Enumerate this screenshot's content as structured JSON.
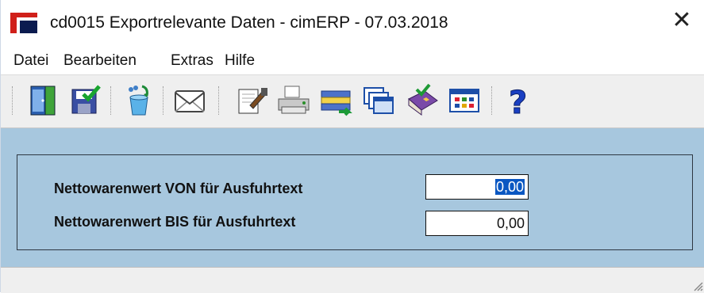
{
  "window": {
    "title": "cd0015 Exportrelevante Daten - cimERP - 07.03.2018",
    "close_glyph": "✕"
  },
  "menu": {
    "items": [
      "Datei",
      "Bearbeiten",
      "Extras",
      "Hilfe"
    ]
  },
  "toolbar": {
    "buttons": [
      {
        "icon": "exit-door-icon"
      },
      {
        "icon": "save-disk-icon"
      },
      {
        "icon": "recycle-bin-icon"
      },
      {
        "icon": "mail-envelope-icon"
      },
      {
        "icon": "edit-document-icon"
      },
      {
        "icon": "printer-icon"
      },
      {
        "icon": "transfer-list-icon"
      },
      {
        "icon": "windows-cascade-icon"
      },
      {
        "icon": "book-icon"
      },
      {
        "icon": "calculator-grid-icon"
      },
      {
        "icon": "help-question-icon"
      }
    ]
  },
  "form": {
    "fields": [
      {
        "label": "Nettowarenwert VON für Ausfuhrtext",
        "value": "0,00",
        "selected": true
      },
      {
        "label": "Nettowarenwert BIS für Ausfuhrtext",
        "value": "0,00",
        "selected": false
      }
    ]
  },
  "colors": {
    "form_background": "#a7c7de",
    "selection": "#0a57c2",
    "brand_red": "#d0201a",
    "brand_navy": "#0b1b4f"
  }
}
